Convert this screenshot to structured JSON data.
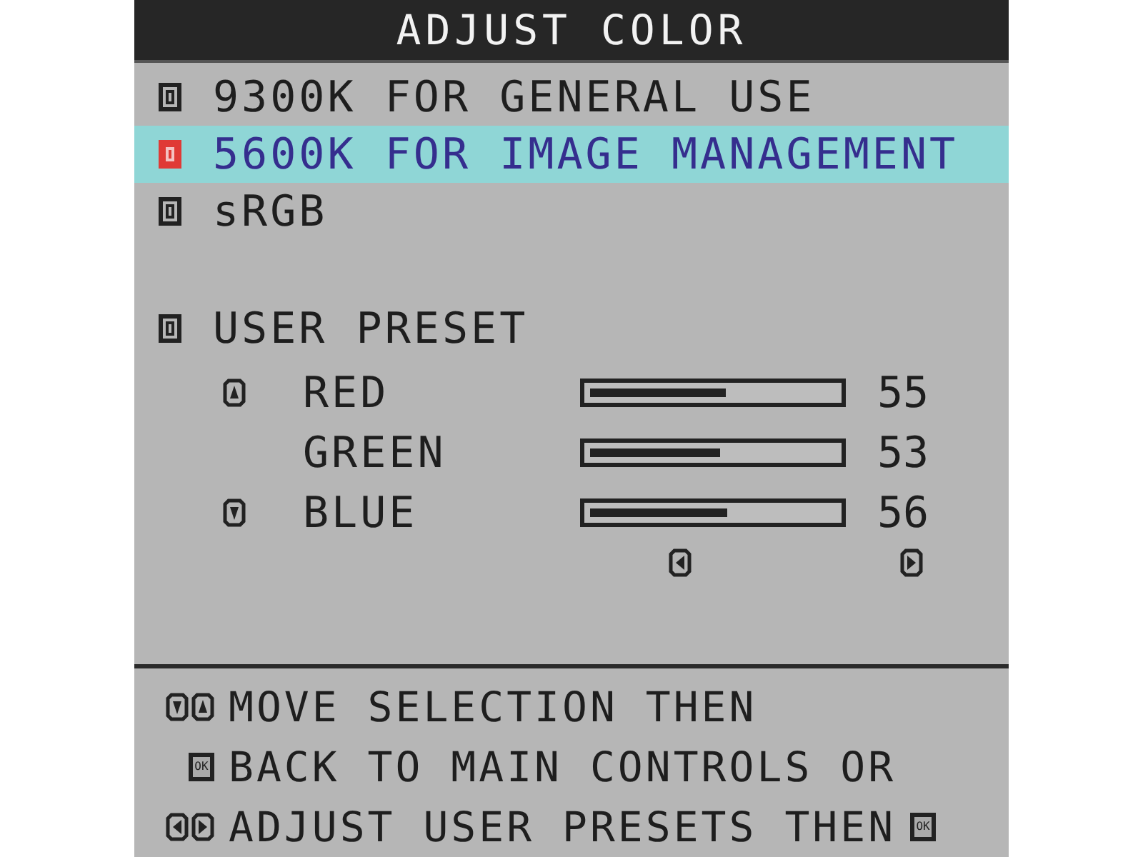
{
  "title": "ADJUST COLOR",
  "options": [
    {
      "label": "9300K FOR GENERAL USE",
      "selected": false
    },
    {
      "label": "5600K FOR IMAGE MANAGEMENT",
      "selected": true
    },
    {
      "label": "sRGB",
      "selected": false
    }
  ],
  "user_preset": {
    "label": "USER PRESET",
    "selected": false
  },
  "channels": [
    {
      "name": "RED",
      "level": 0.55,
      "reading": "55",
      "kind": "up"
    },
    {
      "name": "GREEN",
      "level": 0.53,
      "reading": "53",
      "kind": "plain"
    },
    {
      "name": "BLUE",
      "level": 0.56,
      "reading": "56",
      "kind": "down"
    }
  ],
  "adjust_keys": [
    {
      "kind": "left"
    },
    {
      "kind": "right"
    }
  ],
  "hints": [
    {
      "lead": [
        {
          "kind": "down"
        },
        {
          "kind": "up"
        }
      ],
      "text": "MOVE SELECTION THEN"
    },
    {
      "lead": [
        {
          "kind": "ok",
          "label": "OK"
        }
      ],
      "text": "BACK TO MAIN CONTROLS OR"
    },
    {
      "lead": [
        {
          "kind": "left"
        },
        {
          "kind": "right"
        }
      ],
      "text": "ADJUST USER PRESETS THEN",
      "tail": [
        {
          "kind": "ok",
          "label": "OK"
        }
      ]
    }
  ]
}
